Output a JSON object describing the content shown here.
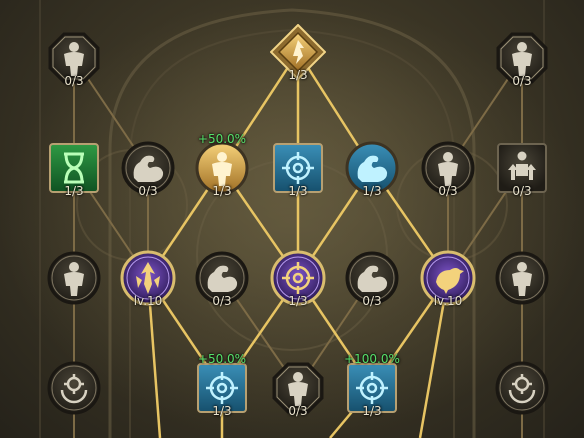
{
  "screen": "skill-tree",
  "colors": {
    "line": "#e7c463",
    "line_dim": "#7d6b46",
    "bonus": "#56e06a",
    "text": "#e9e2cc"
  },
  "nodes": [
    {
      "id": "r0-left-body",
      "icon": "body-silhouette-icon",
      "style": "octagon-dark",
      "label": "0/3"
    },
    {
      "id": "r0-center-core",
      "icon": "flame-core-icon",
      "style": "diamond-gold",
      "label": "1/3"
    },
    {
      "id": "r0-right-body",
      "icon": "body-silhouette-icon",
      "style": "octagon-dark",
      "label": "0/3"
    },
    {
      "id": "r1-hourglass",
      "icon": "hourglass-icon",
      "style": "square-green",
      "label": "1/3"
    },
    {
      "id": "r1-arm-dim",
      "icon": "flexed-arm-icon",
      "style": "circle-dark",
      "label": "0/3"
    },
    {
      "id": "r1-body-gold",
      "icon": "body-silhouette-icon",
      "style": "circle-gold",
      "label": "1/3",
      "bonus": "+50.0%"
    },
    {
      "id": "r1-target",
      "icon": "crosshair-icon",
      "style": "square-blue",
      "label": "1/3"
    },
    {
      "id": "r1-arm-blue",
      "icon": "flexed-arm-icon",
      "style": "circle-blue",
      "label": "1/3"
    },
    {
      "id": "r1-body-dim",
      "icon": "body-silhouette-icon",
      "style": "circle-dark",
      "label": "0/3"
    },
    {
      "id": "r1-arrows",
      "icon": "upgrade-arrows-icon",
      "style": "square-dark",
      "label": "0/3"
    },
    {
      "id": "r2-body-left",
      "icon": "body-silhouette-icon",
      "style": "circle-dark",
      "label": ""
    },
    {
      "id": "r2-emblem-left",
      "icon": "flame-emblem-icon",
      "style": "circle-purple",
      "label": "lv.10"
    },
    {
      "id": "r2-arm-left",
      "icon": "flexed-arm-icon",
      "style": "circle-dark",
      "label": "0/3"
    },
    {
      "id": "r2-center-target",
      "icon": "crosshair-icon",
      "style": "circle-purple",
      "label": "1/3"
    },
    {
      "id": "r2-arm-right",
      "icon": "flexed-arm-icon",
      "style": "circle-dark",
      "label": "0/3"
    },
    {
      "id": "r2-bird",
      "icon": "bird-icon",
      "style": "circle-purple",
      "label": "lv.10"
    },
    {
      "id": "r2-body-right",
      "icon": "body-silhouette-icon",
      "style": "circle-dark",
      "label": ""
    },
    {
      "id": "r3-moon-left",
      "icon": "crescent-target-icon",
      "style": "circle-dark",
      "label": ""
    },
    {
      "id": "r3-target-left",
      "icon": "crosshair-icon",
      "style": "square-blue",
      "label": "1/3",
      "bonus": "+50.0%"
    },
    {
      "id": "r3-body-center",
      "icon": "body-silhouette-icon",
      "style": "octagon-dark",
      "label": "0/3"
    },
    {
      "id": "r3-target-right",
      "icon": "crosshair-icon",
      "style": "square-blue",
      "label": "1/3",
      "bonus": "+100.0%"
    },
    {
      "id": "r3-moon-right",
      "icon": "crescent-target-icon",
      "style": "circle-dark",
      "label": ""
    }
  ]
}
